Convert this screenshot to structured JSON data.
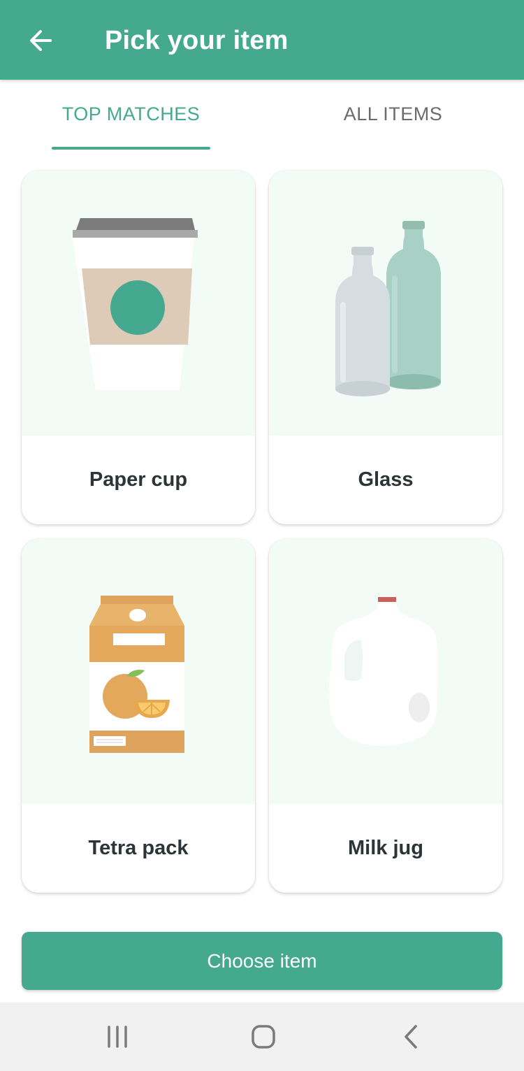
{
  "app_bar": {
    "title": "Pick your item",
    "back_icon": "arrow-left-icon"
  },
  "tabs": [
    {
      "label": "TOP MATCHES",
      "selected": true
    },
    {
      "label": "ALL ITEMS",
      "selected": false
    }
  ],
  "items": [
    {
      "label": "Paper cup",
      "icon": "paper-cup-illustration"
    },
    {
      "label": "Glass",
      "icon": "glass-bottles-illustration"
    },
    {
      "label": "Tetra pack",
      "icon": "tetra-pack-illustration"
    },
    {
      "label": "Milk jug",
      "icon": "milk-jug-illustration"
    }
  ],
  "choose_button": {
    "label": "Choose item"
  },
  "nav_bar": {
    "icons": [
      "recent-apps-icon",
      "home-icon",
      "back-icon"
    ]
  },
  "colors": {
    "primary": "#44a98e",
    "card_image_bg": "#f3fbf7",
    "text_dark": "#2b3436",
    "tab_inactive": "#6b6b6b"
  }
}
